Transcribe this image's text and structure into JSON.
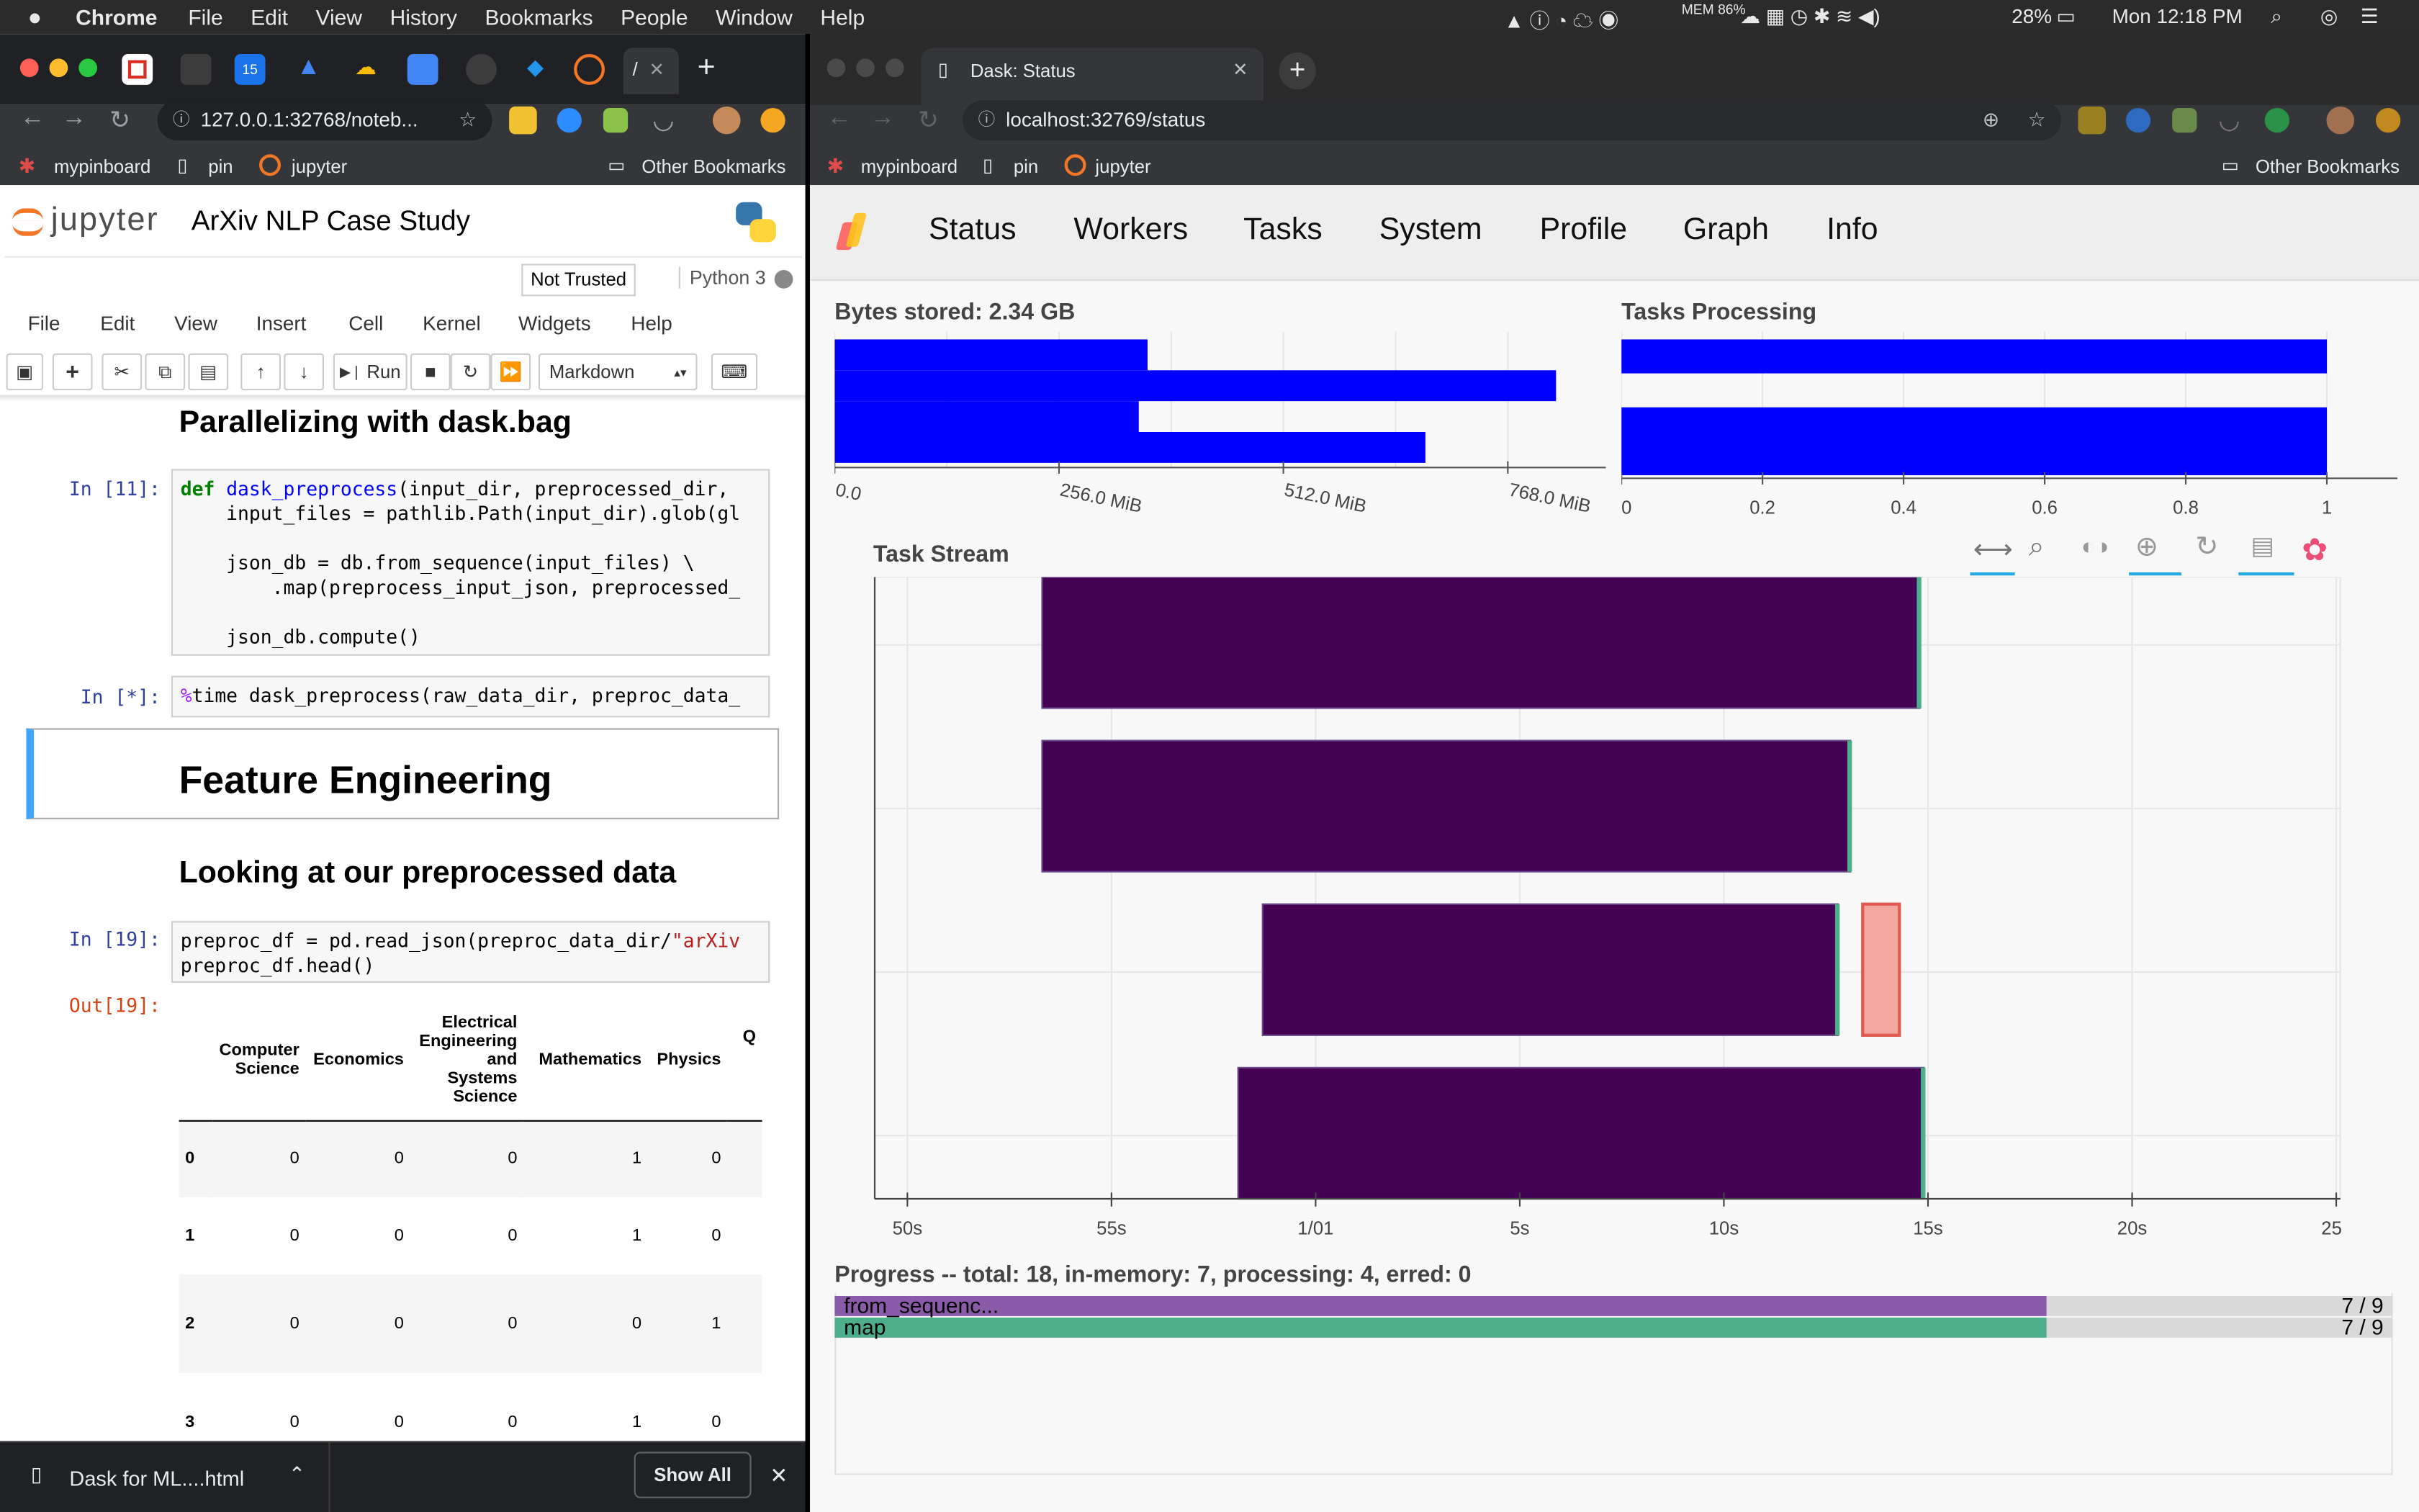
{
  "menubar": {
    "app": "Chrome",
    "items": [
      "File",
      "Edit",
      "View",
      "History",
      "Bookmarks",
      "People",
      "Window",
      "Help"
    ],
    "mem": "MEM 86%",
    "battery": "28%",
    "clock": "Mon 12:18 PM"
  },
  "left_browser": {
    "url": "127.0.0.1:32768/noteb...",
    "bookmarks": [
      "mypinboard",
      "pin",
      "jupyter"
    ],
    "other_bookmarks": "Other Bookmarks"
  },
  "jupyter": {
    "logo": "jupyter",
    "title": "ArXiv NLP Case Study",
    "not_trusted": "Not Trusted",
    "kernel": "Python 3",
    "menu": [
      "File",
      "Edit",
      "View",
      "Insert",
      "Cell",
      "Kernel",
      "Widgets",
      "Help"
    ],
    "run_label": "Run",
    "cell_type": "Markdown",
    "heading_parallel": "Parallelizing with dask.bag",
    "prompt_11": "In [11]:",
    "prompt_star": "In [*]:",
    "prompt_19": "In [19]:",
    "out_19": "Out[19]:",
    "heading_feature": "Feature Engineering",
    "heading_looking": "Looking at our preprocessed data",
    "table": {
      "columns": [
        "Computer Science",
        "Economics",
        "Electrical Engineering and Systems Science",
        "Mathematics",
        "Physics",
        "Q"
      ],
      "rows": [
        {
          "index": "0",
          "values": [
            "0",
            "0",
            "0",
            "1",
            "0"
          ]
        },
        {
          "index": "1",
          "values": [
            "0",
            "0",
            "0",
            "1",
            "0"
          ]
        },
        {
          "index": "2",
          "values": [
            "0",
            "0",
            "0",
            "0",
            "1"
          ]
        },
        {
          "index": "3",
          "values": [
            "0",
            "0",
            "0",
            "1",
            "0"
          ]
        }
      ]
    }
  },
  "download_bar": {
    "file": "Dask for ML....html",
    "show_all": "Show All"
  },
  "right_browser": {
    "tab_title": "Dask: Status",
    "url": "localhost:32769/status",
    "bookmarks": [
      "mypinboard",
      "pin",
      "jupyter"
    ],
    "other_bookmarks": "Other Bookmarks"
  },
  "dask": {
    "nav": [
      "Status",
      "Workers",
      "Tasks",
      "System",
      "Profile",
      "Graph",
      "Info"
    ],
    "bytes_title": "Bytes stored: 2.34 GB",
    "bytes_ticks": [
      "0.0",
      "256.0 MiB",
      "512.0 MiB",
      "768.0 MiB"
    ],
    "tasks_title": "Tasks Processing",
    "tasks_ticks": [
      "0",
      "0.2",
      "0.4",
      "0.6",
      "0.8",
      "1"
    ],
    "stream_title": "Task Stream",
    "stream_ticks": [
      "50s",
      "55s",
      "1/01",
      "5s",
      "10s",
      "15s",
      "20s",
      "25s"
    ],
    "progress_title": "Progress -- total: 18, in-memory: 7, processing: 4, erred: 0",
    "colors": {
      "bar": "#0000ff",
      "task": "#440154",
      "error": "#f4a6a0",
      "map": "#4cae8b",
      "from_seq": "#8a5ba8"
    }
  },
  "chart_data": [
    {
      "type": "bar",
      "title": "Bytes stored: 2.34 GB",
      "orientation": "horizontal",
      "x_unit": "MiB",
      "series": [
        {
          "values": [
            357,
            823,
            347,
            674
          ]
        }
      ],
      "xlim": [
        0,
        880
      ]
    },
    {
      "type": "bar",
      "title": "Tasks Processing",
      "orientation": "horizontal",
      "series": [
        {
          "values": [
            1,
            1
          ]
        }
      ],
      "xlim": [
        0,
        1.1
      ]
    },
    {
      "type": "timeline",
      "title": "Task Stream",
      "x_unit": "seconds",
      "tasks": [
        {
          "worker": 0,
          "start": 53.3,
          "end": 74.8,
          "color": "task"
        },
        {
          "worker": 1,
          "start": 53.3,
          "end": 73.1,
          "color": "task"
        },
        {
          "worker": 2,
          "start": 58.7,
          "end": 72.8,
          "color": "task"
        },
        {
          "worker": 2,
          "start": 73.4,
          "end": 74.3,
          "color": "error"
        },
        {
          "worker": 3,
          "start": 58.1,
          "end": 74.9,
          "color": "task"
        }
      ],
      "xlim": [
        49.2,
        85.1
      ]
    },
    {
      "type": "progress",
      "title": "Progress -- total: 18, in-memory: 7, processing: 4, erred: 0",
      "rows": [
        {
          "name": "from_sequenc...",
          "done": 7,
          "total": 9,
          "label": "7 / 9"
        },
        {
          "name": "map",
          "done": 7,
          "total": 9,
          "label": "7 / 9"
        }
      ]
    }
  ]
}
